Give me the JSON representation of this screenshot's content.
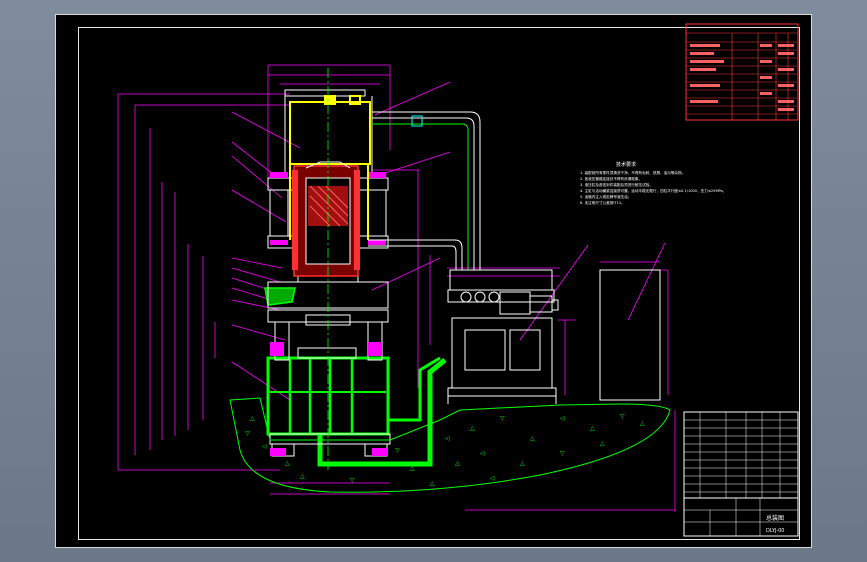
{
  "drawing": {
    "title_block_name": "总装图",
    "title_block_code": "DLYJ-00",
    "notes_title": "技术要求",
    "notes": [
      "1. 装配前所有零件须清洗干净，不得有毛刺、铁屑、油污等杂物。",
      "2. 各液压管路连接处不得有渗漏现象。",
      "3. 液压缸及各密封件装配后须进行耐压试验。",
      "4. 主缸与活动横梁连接须可靠，运动平稳无爬行，四柱平行度≤0.1/1000，压力≤25MPa。",
      "5. 油箱内注入规定牌号液压油。",
      "6. 未注明尺寸公差按IT12。"
    ]
  },
  "colors": {
    "background": "#000000",
    "outline": "#ffffff",
    "dimension": "#ff00ff",
    "cylinder": "#ffff00",
    "hydraulic": "#00ff00",
    "section": "#ff3030",
    "table": "#ff3030"
  }
}
